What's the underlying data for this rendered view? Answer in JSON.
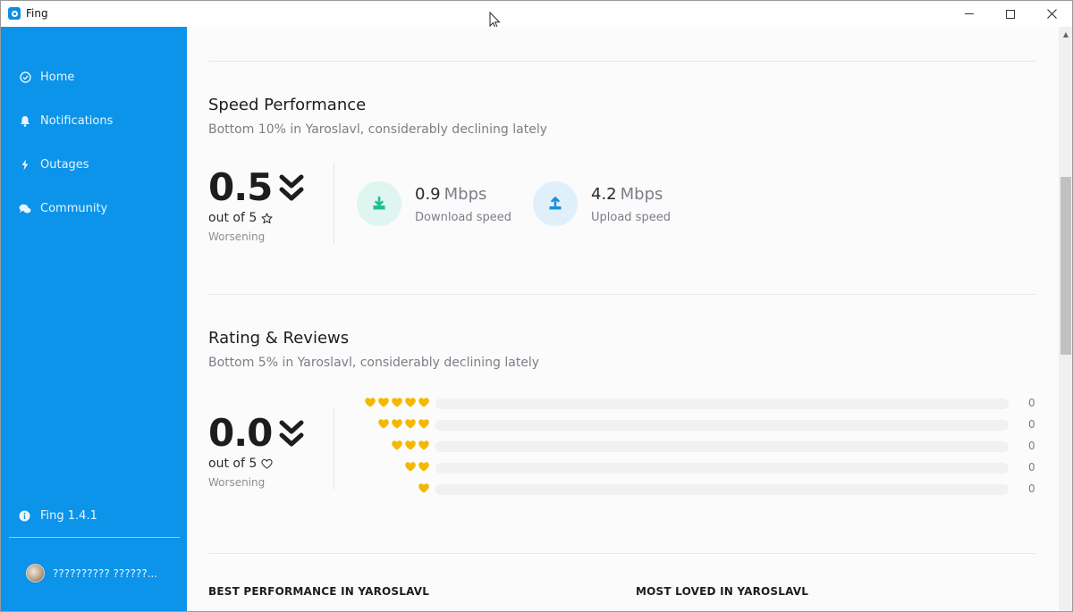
{
  "window": {
    "title": "Fing"
  },
  "sidebar": {
    "items": [
      {
        "label": "Home",
        "icon": "check-circle-icon"
      },
      {
        "label": "Notifications",
        "icon": "bell-icon"
      },
      {
        "label": "Outages",
        "icon": "bolt-icon"
      },
      {
        "label": "Community",
        "icon": "chat-bubbles-icon"
      }
    ],
    "version": "Fing 1.4.1",
    "user_name": "?????????? ??????..."
  },
  "speed": {
    "title": "Speed Performance",
    "subtitle": "Bottom 10% in Yaroslavl, considerably declining lately",
    "score": "0.5",
    "out_of": "out of 5",
    "trend": "Worsening",
    "download_value": "0.9",
    "download_unit": "Mbps",
    "download_label": "Download speed",
    "upload_value": "4.2",
    "upload_unit": "Mbps",
    "upload_label": "Upload speed"
  },
  "rating": {
    "title": "Rating & Reviews",
    "subtitle": "Bottom 5% in Yaroslavl, considerably declining lately",
    "score": "0.0",
    "out_of": "out of 5",
    "trend": "Worsening",
    "rows": [
      {
        "hearts": 5,
        "count": "0",
        "fraction": 0
      },
      {
        "hearts": 4,
        "count": "0",
        "fraction": 0
      },
      {
        "hearts": 3,
        "count": "0",
        "fraction": 0
      },
      {
        "hearts": 2,
        "count": "0",
        "fraction": 0
      },
      {
        "hearts": 1,
        "count": "0",
        "fraction": 0
      }
    ]
  },
  "bottom": {
    "best_performance": "BEST PERFORMANCE IN YAROSLAVL",
    "most_loved": "MOST LOVED IN YAROSLAVL"
  },
  "colors": {
    "sidebar": "#0b94ea",
    "heart": "#f5b800",
    "download": "#1fbf8f",
    "upload": "#1a8fe0"
  }
}
